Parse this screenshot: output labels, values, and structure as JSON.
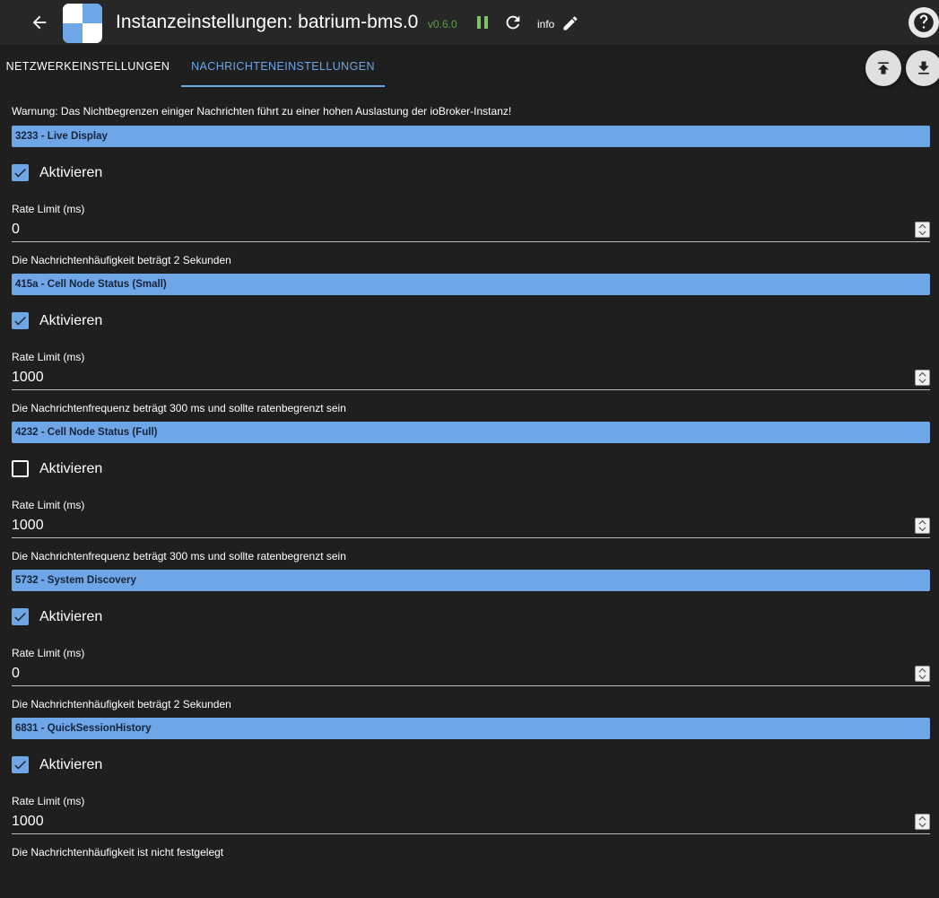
{
  "header": {
    "title": "Instanzeinstellungen: batrium-bms.0",
    "version": "v0.6.0",
    "info_label": "info"
  },
  "tabs": [
    {
      "label": "NETZWERKEINSTELLUNGEN"
    },
    {
      "label": "NACHRICHTENEINSTELLUNGEN"
    }
  ],
  "warning": "Warnung: Das Nichtbegrenzen einiger Nachrichten führt zu einer hohen Auslastung der ioBroker-Instanz!",
  "messages": [
    {
      "name": "3233 - Live Display",
      "enable_label": "Aktivieren",
      "enabled": true,
      "rate_label": "Rate Limit (ms)",
      "rate_value": "0",
      "note": "Die Nachrichtenhäufigkeit beträgt 2 Sekunden"
    },
    {
      "name": "415a - Cell Node Status (Small)",
      "enable_label": "Aktivieren",
      "enabled": true,
      "rate_label": "Rate Limit (ms)",
      "rate_value": "1000",
      "note": "Die Nachrichtenfrequenz beträgt 300 ms und sollte ratenbegrenzt sein"
    },
    {
      "name": "4232 - Cell Node Status (Full)",
      "enable_label": "Aktivieren",
      "enabled": false,
      "rate_label": "Rate Limit (ms)",
      "rate_value": "1000",
      "note": "Die Nachrichtenfrequenz beträgt 300 ms und sollte ratenbegrenzt sein"
    },
    {
      "name": "5732 - System Discovery",
      "enable_label": "Aktivieren",
      "enabled": true,
      "rate_label": "Rate Limit (ms)",
      "rate_value": "0",
      "note": "Die Nachrichtenhäufigkeit beträgt 2 Sekunden"
    },
    {
      "name": "6831 - QuickSessionHistory",
      "enable_label": "Aktivieren",
      "enabled": true,
      "rate_label": "Rate Limit (ms)",
      "rate_value": "1000",
      "note": "Die Nachrichtenhäufigkeit ist nicht festgelegt"
    }
  ],
  "icons": {
    "back": "arrow-left-icon",
    "pause": "pause-icon",
    "reload": "reload-icon",
    "edit": "pencil-icon",
    "help": "help-icon",
    "upload": "upload-icon",
    "download": "download-icon",
    "checkbox_checked": "checkbox-checked-icon",
    "spinner": "spinner-arrows-icon"
  },
  "colors": {
    "accent": "#6ea6e8",
    "background": "#1f1f1f",
    "version": "#5f9a4a",
    "running": "#7ec36a"
  }
}
